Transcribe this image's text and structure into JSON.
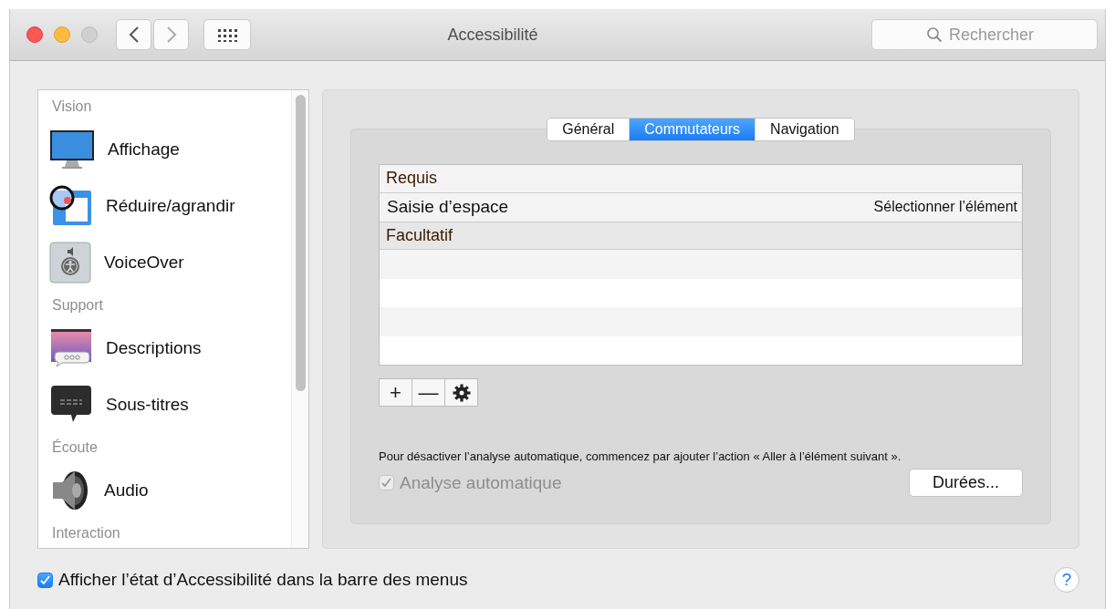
{
  "window": {
    "title": "Accessibilité"
  },
  "search": {
    "placeholder": "Rechercher"
  },
  "sidebar": {
    "items": [
      {
        "kind": "header",
        "label": "Vision"
      },
      {
        "kind": "display",
        "label": "Affichage",
        "selected": false
      },
      {
        "kind": "zoom",
        "label": "Réduire/agrandir",
        "selected": false
      },
      {
        "kind": "voiceover",
        "label": "VoiceOver",
        "selected": false
      },
      {
        "kind": "header",
        "label": "Support"
      },
      {
        "kind": "descriptions",
        "label": "Descriptions",
        "selected": false
      },
      {
        "kind": "captions",
        "label": "Sous-titres",
        "selected": false
      },
      {
        "kind": "header",
        "label": "Écoute"
      },
      {
        "kind": "audio",
        "label": "Audio",
        "selected": false
      },
      {
        "kind": "header",
        "label": "Interaction"
      }
    ]
  },
  "tabs": [
    {
      "label": "Général",
      "selected": false
    },
    {
      "label": "Commutateurs",
      "selected": true
    },
    {
      "label": "Navigation",
      "selected": false
    }
  ],
  "table": {
    "rows": [
      {
        "kind": "group",
        "label": "Requis"
      },
      {
        "kind": "row",
        "label": "Saisie d’espace",
        "action": "Sélectionner l’élément"
      },
      {
        "kind": "group",
        "label": "Facultatif"
      }
    ]
  },
  "table_buttons": [
    {
      "kind": "plus",
      "label": "+"
    },
    {
      "kind": "minus",
      "label": "—"
    },
    {
      "kind": "gear"
    }
  ],
  "note": "Pour désactiver l’analyse automatique, commencez par ajouter l’action « Aller à l’élément suivant ».",
  "auto_scan": {
    "label": "Analyse automatique",
    "checked": true,
    "disabled": true
  },
  "durations_button": "Durées...",
  "footer": {
    "checkbox": {
      "label": "Afficher l’état d’Accessibilité dans la barre des menus",
      "checked": true
    },
    "help": "?"
  }
}
